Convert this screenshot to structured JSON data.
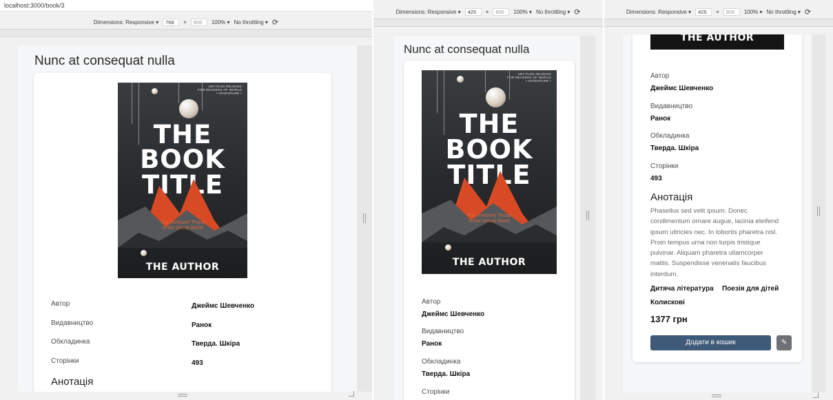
{
  "browser": {
    "url": "localhost:3000/book/3"
  },
  "devtools": {
    "dimensions_label": "Dimensions: Responsive",
    "zoom": "100%",
    "throttling": "No throttling",
    "panels": [
      {
        "width": "768",
        "height": "806"
      },
      {
        "width": "425",
        "height": "806"
      },
      {
        "width": "425",
        "height": "806"
      }
    ]
  },
  "book": {
    "title": "Nunc at consequat nulla",
    "cover": {
      "small_text": [
        "UNTITLED READING",
        "FOR READERS OF WORLD",
        "• ADVENTURE •"
      ],
      "title_lines": [
        "THE",
        "BOOK",
        "TITLE"
      ],
      "subtitle_lines": [
        "The Imminent Threat",
        "of the Virtual World"
      ],
      "author": "THE AUTHOR"
    },
    "details": [
      {
        "label": "Автор",
        "value": "Джеймс Шевченко"
      },
      {
        "label": "Видавництво",
        "value": "Ранок"
      },
      {
        "label": "Обкладинка",
        "value": "Тверда. Шкіра"
      },
      {
        "label": "Сторінки",
        "value": "493"
      }
    ],
    "annotation_heading": "Анотація",
    "annotation_lines": [
      "Phasellus sed velit ipsum. Donec",
      "condimentum ornare augue, lacinia eleifend",
      "ipsum ultricies nec. In lobortis pharetra nisl.",
      "Proin tempus urna non turpis tristique",
      "pulvinar. Aliquam pharetra ullamcorper",
      "mattis. Suspendisse venenatis faucibus",
      "interdum."
    ],
    "genres": [
      "Дитяча література",
      "Поезія для дітей",
      "Колискові"
    ],
    "price": "1377 грн",
    "add_to_cart": "Додати в кошик"
  },
  "icons": {
    "rotate": "rotate-icon",
    "edit": "pencil-icon",
    "dropdown": "caret-down-icon"
  }
}
